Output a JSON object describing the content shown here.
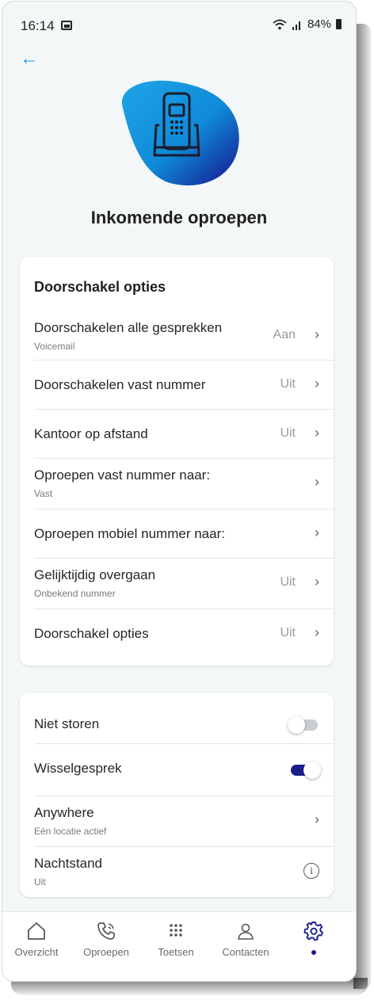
{
  "status": {
    "time": "16:14",
    "battery": "84%"
  },
  "page": {
    "title": "Inkomende oproepen"
  },
  "forwarding": {
    "heading": "Doorschakel opties",
    "rows": [
      {
        "label": "Doorschakelen alle gesprekken",
        "sub": "Voicemail",
        "value": "Aan"
      },
      {
        "label": "Doorschakelen vast nummer",
        "sub": "",
        "value": "Uit"
      },
      {
        "label": "Kantoor op afstand",
        "sub": "",
        "value": "Uit"
      },
      {
        "label": "Oproepen vast nummer naar:",
        "sub": "Vast",
        "value": ""
      },
      {
        "label": "Oproepen mobiel nummer naar:",
        "sub": "",
        "value": ""
      },
      {
        "label": "Gelijktijdig overgaan",
        "sub": "Onbekend nummer",
        "value": "Uit"
      },
      {
        "label": "Doorschakel opties",
        "sub": "",
        "value": "Uit"
      }
    ]
  },
  "settings": {
    "dnd": {
      "label": "Niet storen",
      "enabled": false
    },
    "call_waiting": {
      "label": "Wisselgesprek",
      "enabled": true
    },
    "anywhere": {
      "label": "Anywhere",
      "sub": "Eén locatie actief"
    },
    "night": {
      "label": "Nachtstand",
      "sub": "Uit"
    }
  },
  "nav": {
    "items": [
      {
        "label": "Overzicht",
        "icon": "home-icon"
      },
      {
        "label": "Oproepen",
        "icon": "phone-icon"
      },
      {
        "label": "Toetsen",
        "icon": "dialpad-icon"
      },
      {
        "label": "Contacten",
        "icon": "person-icon"
      },
      {
        "label": "",
        "icon": "gear-icon",
        "active": true
      }
    ]
  },
  "colors": {
    "accent": "#1aa0e0",
    "brand_dark": "#1b1f8c",
    "background": "#f3f7f8"
  }
}
